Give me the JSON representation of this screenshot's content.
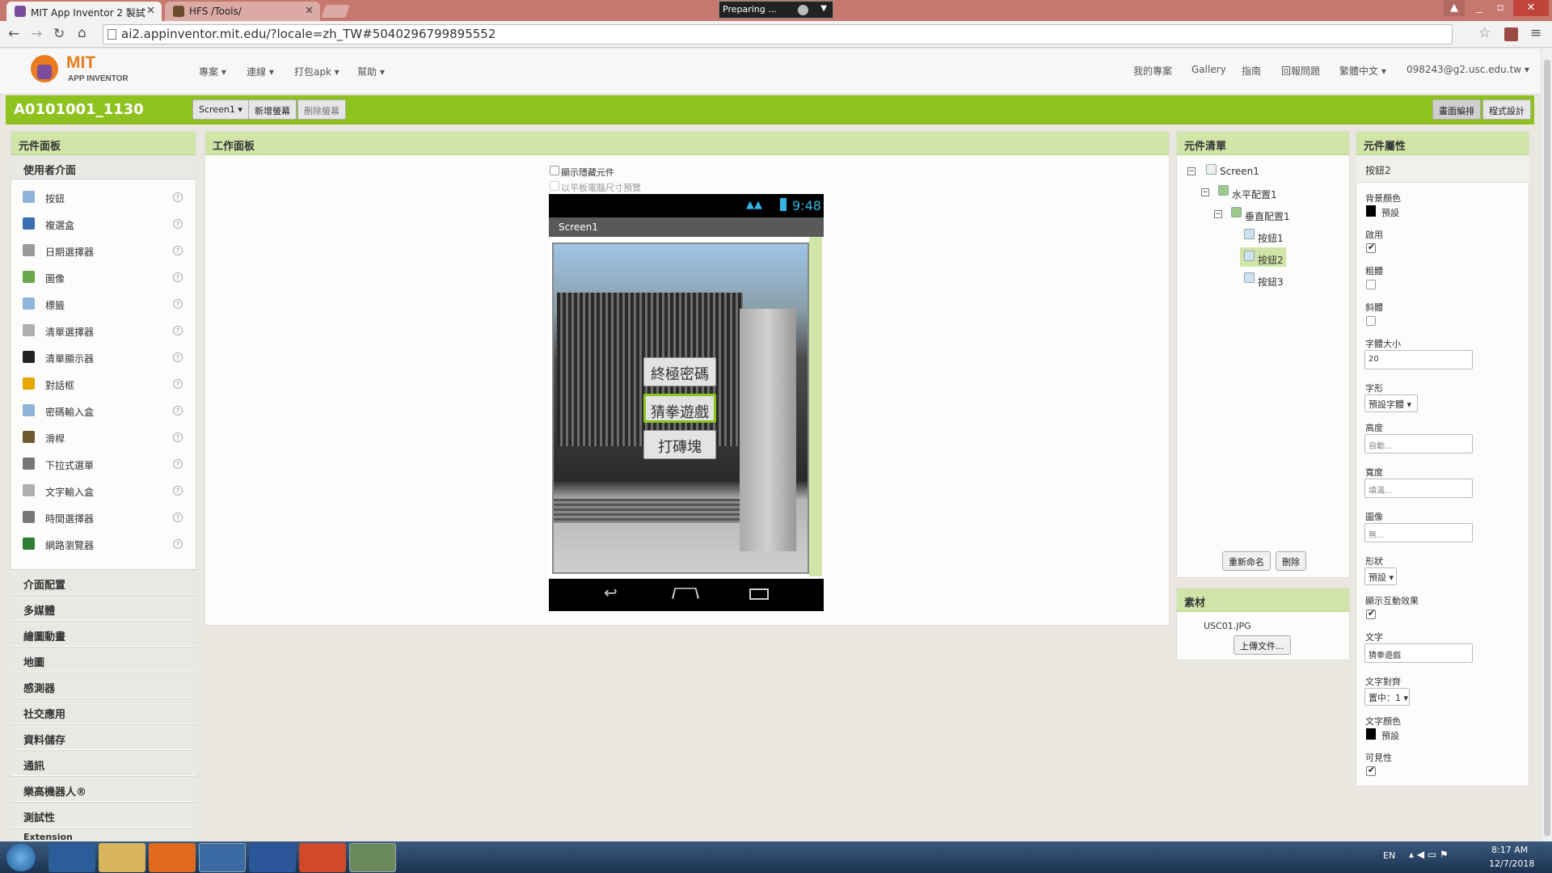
{
  "browser": {
    "tabs": [
      {
        "title": "MIT App Inventor 2 製試"
      },
      {
        "title": "HFS /Tools/"
      }
    ],
    "preparing": "Preparing ...",
    "url": "ai2.appinventor.mit.edu/?locale=zh_TW#5040296799895552",
    "window_buttons": [
      "_",
      "▫",
      "✕"
    ]
  },
  "header": {
    "logo_mit": "MIT",
    "logo_sub": "APP INVENTOR",
    "menus": [
      "專案",
      "連線",
      "打包apk",
      "幫助"
    ],
    "right_links": [
      "我的專案",
      "Gallery",
      "指南",
      "回報問題",
      "繁體中文",
      "098243@g2.usc.edu.tw"
    ]
  },
  "toolbar": {
    "project_name": "A0101001_1130",
    "screen_select": "Screen1",
    "add_screen": "新增螢幕",
    "remove_screen": "刪除螢幕",
    "designer": "畫面編排",
    "blocks": "程式設計"
  },
  "palette": {
    "title": "元件面板",
    "open_category": "使用者介面",
    "items": [
      {
        "label": "按鈕",
        "icon": "button-icon",
        "color": "#8fb3d9"
      },
      {
        "label": "複選盒",
        "icon": "checkbox-icon",
        "color": "#3a6fb0"
      },
      {
        "label": "日期選擇器",
        "icon": "calendar-icon",
        "color": "#9a9a9a"
      },
      {
        "label": "圖像",
        "icon": "image-icon",
        "color": "#6aa84f"
      },
      {
        "label": "標籤",
        "icon": "label-icon",
        "color": "#8fb3d9"
      },
      {
        "label": "清單選擇器",
        "icon": "list-picker-icon",
        "color": "#b0b0b0"
      },
      {
        "label": "清單顯示器",
        "icon": "list-view-icon",
        "color": "#222222"
      },
      {
        "label": "對話框",
        "icon": "warning-icon",
        "color": "#e6a800"
      },
      {
        "label": "密碼輸入盒",
        "icon": "password-icon",
        "color": "#8fb3d9"
      },
      {
        "label": "滑桿",
        "icon": "slider-icon",
        "color": "#6b5a2e"
      },
      {
        "label": "下拉式選單",
        "icon": "spinner-icon",
        "color": "#777777"
      },
      {
        "label": "文字輸入盒",
        "icon": "textbox-icon",
        "color": "#b0b0b0"
      },
      {
        "label": "時間選擇器",
        "icon": "clock-icon",
        "color": "#777777"
      },
      {
        "label": "網路瀏覽器",
        "icon": "globe-icon",
        "color": "#2e7d32"
      }
    ],
    "help": "?",
    "categories": [
      "介面配置",
      "多媒體",
      "繪圖動畫",
      "地圖",
      "感測器",
      "社交應用",
      "資料儲存",
      "通訊",
      "樂高機器人®",
      "測試性",
      "Extension"
    ]
  },
  "viewer": {
    "title": "工作面板",
    "show_hidden": "顯示隱藏元件",
    "tablet_preview": "以平板電腦尺寸預覽",
    "time": "9:48",
    "screen_title": "Screen1",
    "buttons": [
      "終極密碼",
      "猜拳遊戲",
      "打磚塊"
    ]
  },
  "components": {
    "title": "元件清單",
    "tree": [
      "Screen1",
      "水平配置1",
      "垂直配置1",
      "按鈕1",
      "按鈕2",
      "按鈕3"
    ],
    "rename": "重新命名",
    "delete": "刪除"
  },
  "media": {
    "title": "素材",
    "file": "USC01.JPG",
    "upload": "上傳文件..."
  },
  "properties": {
    "title": "元件屬性",
    "component": "按鈕2",
    "bg_label": "背景顏色",
    "bg_value": "預設",
    "enabled_label": "啟用",
    "bold_label": "粗體",
    "italic_label": "斜體",
    "fontsize_label": "字體大小",
    "fontsize_value": "20",
    "font_label": "字形",
    "font_value": "預設字體",
    "height_label": "高度",
    "height_value": "自動...",
    "width_label": "寬度",
    "width_value": "填滿...",
    "image_label": "圖像",
    "image_value": "無...",
    "shape_label": "形狀",
    "shape_value": "預設",
    "feedback_label": "顯示互動效果",
    "text_label": "文字",
    "text_value": "猜拳遊戲",
    "align_label": "文字對齊",
    "align_value": "置中：1",
    "textcolor_label": "文字顏色",
    "textcolor_value": "預設",
    "visible_label": "可見性"
  },
  "taskbar": {
    "lang": "EN",
    "time": "8:17 AM",
    "date": "12/7/2018"
  }
}
